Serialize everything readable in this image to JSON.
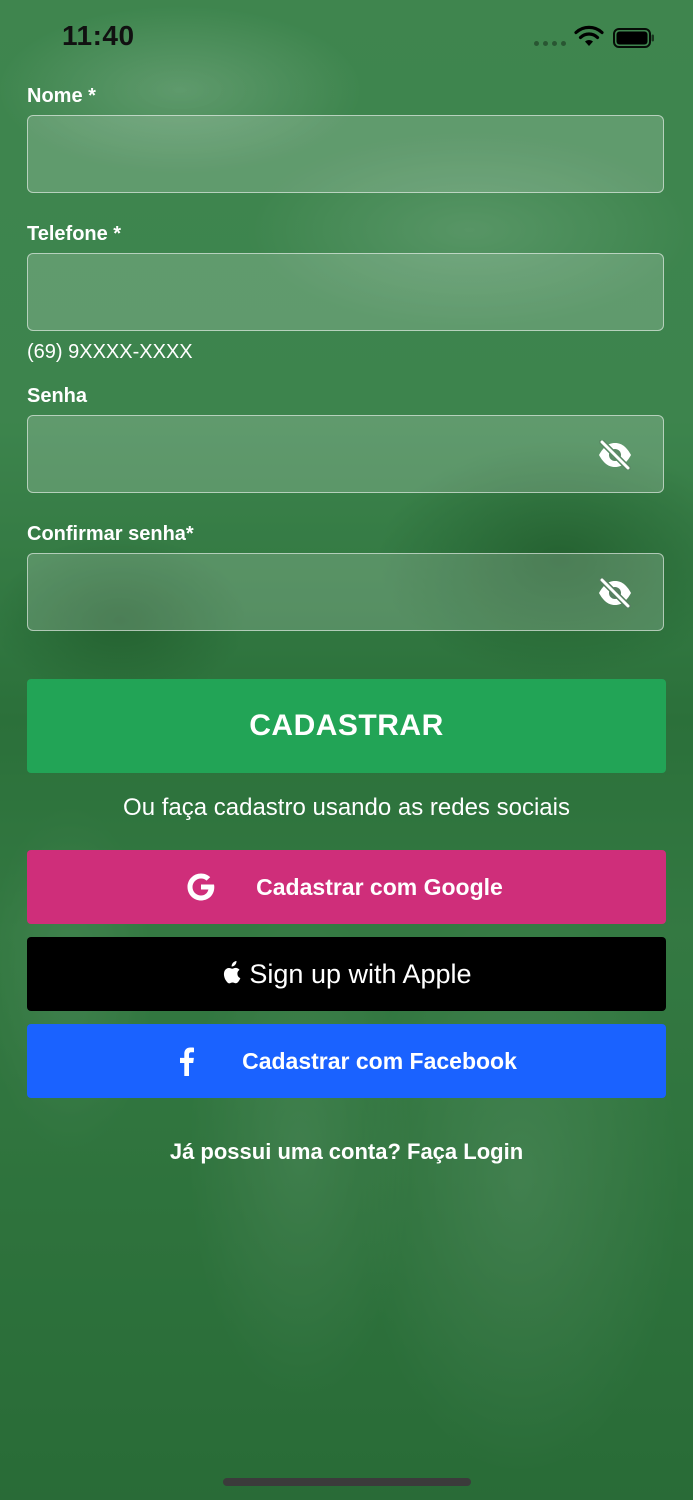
{
  "status_bar": {
    "time": "11:40",
    "signal_icon": "signal-dots-icon",
    "wifi_icon": "wifi-icon",
    "battery_icon": "battery-full-icon"
  },
  "form": {
    "name": {
      "label": "Nome *",
      "value": "",
      "placeholder": ""
    },
    "phone": {
      "label": "Telefone *",
      "value": "",
      "placeholder": "",
      "helper": "(69) 9XXXX-XXXX"
    },
    "password": {
      "label": "Senha",
      "value": "",
      "placeholder": "",
      "toggle_icon": "eye-off-icon"
    },
    "confirm_password": {
      "label": "Confirmar senha*",
      "value": "",
      "placeholder": "",
      "toggle_icon": "eye-off-icon"
    }
  },
  "actions": {
    "register_label": "CADASTRAR",
    "social_caption": "Ou faça cadastro usando as redes sociais",
    "google_label": "Cadastrar com Google",
    "apple_label": "Sign up with Apple",
    "facebook_label": "Cadastrar com Facebook",
    "login_link": "Já possui uma conta? Faça Login"
  },
  "colors": {
    "register_button": "#22a456",
    "google_button": "#cf2e7a",
    "apple_button": "#000000",
    "facebook_button": "#1a62ff",
    "overlay": "#2e6b3c"
  }
}
